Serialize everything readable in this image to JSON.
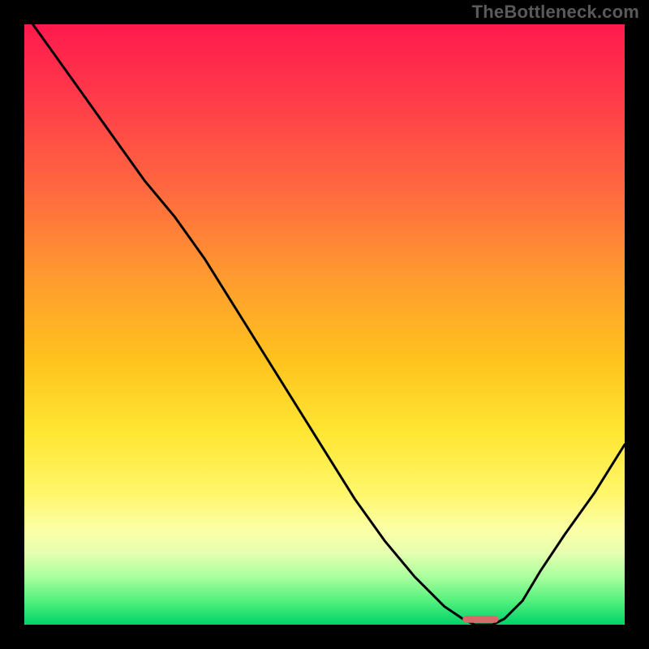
{
  "watermark": "TheBottleneck.com",
  "chart_data": {
    "type": "line",
    "title": "",
    "xlabel": "",
    "ylabel": "",
    "xlim": [
      0,
      100
    ],
    "ylim": [
      0,
      100
    ],
    "grid": false,
    "series": [
      {
        "name": "curve",
        "x": [
          0,
          5,
          10,
          15,
          20,
          25,
          30,
          35,
          40,
          45,
          50,
          55,
          60,
          65,
          70,
          73,
          75,
          78,
          80,
          83,
          86,
          90,
          95,
          100
        ],
        "y": [
          102,
          95,
          88,
          81,
          74,
          68,
          61,
          53,
          45,
          37,
          29,
          21,
          14,
          8,
          3,
          1,
          0,
          0,
          1,
          4,
          9,
          15,
          22,
          30
        ]
      }
    ],
    "marker": {
      "x": 76,
      "y": 0.3,
      "width": 6,
      "height": 1.2
    },
    "colors": {
      "gradient_top": "#ff1a4d",
      "gradient_bottom": "#00d36a",
      "curve": "#000000",
      "marker": "#d96a6a",
      "frame": "#000000"
    }
  }
}
